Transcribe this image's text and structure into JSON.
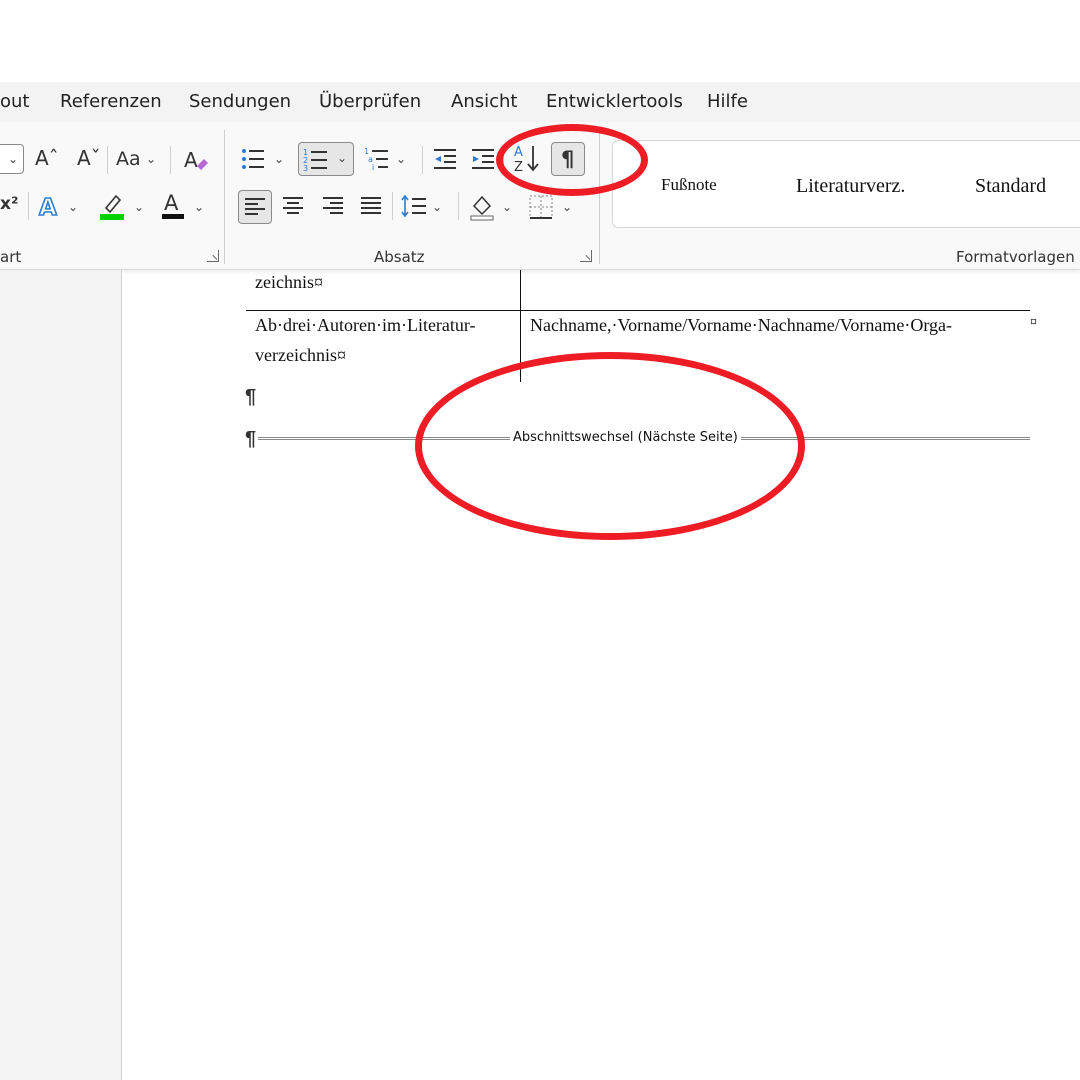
{
  "menu": {
    "items": [
      "out",
      "Referenzen",
      "Sendungen",
      "Überprüfen",
      "Ansicht",
      "Entwicklertools",
      "Hilfe"
    ]
  },
  "ribbon": {
    "font_group": {
      "label": "art",
      "grow_font_glyph": "Aˆ",
      "shrink_font_glyph": "Aˇ",
      "change_case_glyph": "Aa",
      "superscript_glyph": "x²",
      "text_effects_glyph": "A",
      "font_color_glyph": "A",
      "highlight_color": "#00d200",
      "font_color": "#111111",
      "text_effects_color": "#2b7cd3"
    },
    "paragraph_group": {
      "label": "Absatz",
      "sort_glyph": "A↓",
      "show_marks_glyph": "¶"
    },
    "styles_group": {
      "label": "Formatvorlagen",
      "styles": [
        "Fußnote",
        "Literaturverz.",
        "Standard"
      ]
    }
  },
  "document": {
    "row1_cell1_tail": "zeichnis¤",
    "row2_cell1_line1": "Ab·drei·Autoren·im·Literatur-",
    "row2_cell1_line2": "verzeichnis¤",
    "row2_cell2_line1": "Nachname,·Vorname/Vorname·Nachname/Vorname·Orga-",
    "row_end_mark": "¤",
    "pilcrow": "¶",
    "section_break_label": "Abschnittswechsel (Nächste Seite)"
  },
  "colors": {
    "annotation_red": "#ee1c24",
    "menubar_bg": "#f3f3f3",
    "ribbon_bg": "#f9f9f9"
  }
}
